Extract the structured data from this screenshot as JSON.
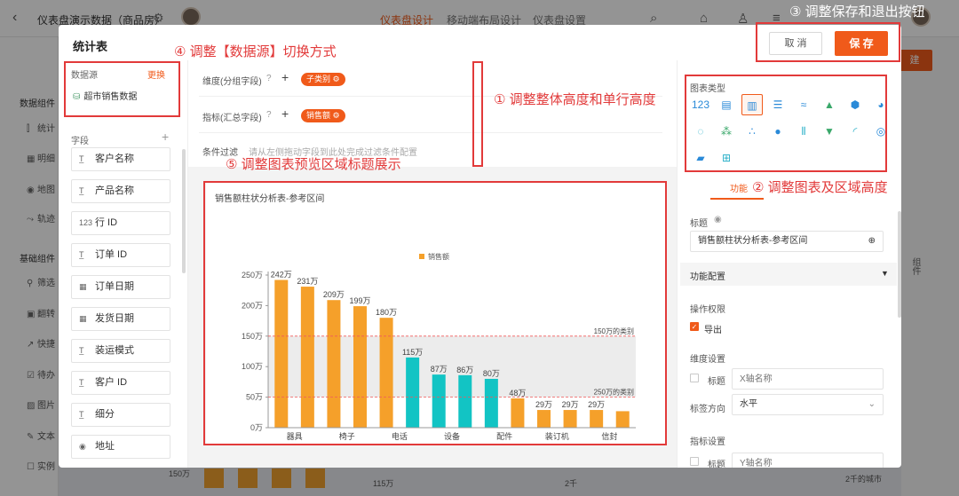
{
  "app": {
    "title": "仪表盘演示数据（商品房）",
    "tabs": [
      "仪表盘设计",
      "移动端布局设计",
      "仪表盘设置"
    ],
    "active_tab": 0,
    "side_sections": [
      "数据组件",
      "基础组件"
    ],
    "side_items_top": [
      "统计",
      "明细",
      "地图",
      "轨迹"
    ],
    "side_items_basic": [
      "筛选",
      "翻转",
      "快捷",
      "待办",
      "图片",
      "文本",
      "实例"
    ],
    "right_vertical_label": "组件",
    "bottom_text": [
      "150万",
      "115万",
      "2千",
      "2千的城市"
    ]
  },
  "modal": {
    "title": "统计表",
    "cancel_label": "取 消",
    "save_label": "保 存"
  },
  "datasource": {
    "label": "数据源",
    "change_label": "更换",
    "name": "超市销售数据"
  },
  "fields": {
    "header": "字段",
    "items": [
      {
        "icon": "T",
        "name": "客户名称"
      },
      {
        "icon": "T",
        "name": "产品名称"
      },
      {
        "icon": "123",
        "name": "行 ID"
      },
      {
        "icon": "T",
        "name": "订单 ID"
      },
      {
        "icon": "cal",
        "name": "订单日期"
      },
      {
        "icon": "cal",
        "name": "发货日期"
      },
      {
        "icon": "T",
        "name": "装运模式"
      },
      {
        "icon": "T",
        "name": "客户 ID"
      },
      {
        "icon": "T",
        "name": "细分"
      },
      {
        "icon": "pin",
        "name": "地址"
      }
    ]
  },
  "config": {
    "dimension_label": "维度(分组字段)",
    "dimension_tag": "子类别",
    "measure_label": "指标(汇总字段)",
    "measure_tag": "销售额",
    "filter_label": "条件过滤",
    "filter_hint": "请从左侧拖动字段到此处完成过滤条件配置"
  },
  "chart_data": {
    "type": "bar",
    "title": "销售额柱状分析表-参考区间",
    "legend": [
      "销售额"
    ],
    "y_unit": "万",
    "y_ticks": [
      "0万",
      "50万",
      "100万",
      "150万",
      "200万",
      "250万"
    ],
    "ylim": [
      0,
      250
    ],
    "categories": [
      "器具",
      "",
      "椅子",
      "",
      "电话",
      "",
      "设备",
      "",
      "配件",
      "",
      "装订机",
      "",
      "信封",
      ""
    ],
    "values": [
      242,
      231,
      209,
      199,
      180,
      115,
      87,
      86,
      80,
      48,
      29,
      29,
      29,
      27
    ],
    "data_labels": [
      "242万",
      "231万",
      "209万",
      "199万",
      "180万",
      "115万",
      "87万",
      "86万",
      "80万",
      "48万",
      "29万",
      "29万",
      "29万",
      ""
    ],
    "bar_colors": [
      "#f5a02a",
      "#f5a02a",
      "#f5a02a",
      "#f5a02a",
      "#f5a02a",
      "#12c4c4",
      "#12c4c4",
      "#12c4c4",
      "#12c4c4",
      "#f5a02a",
      "#f5a02a",
      "#f5a02a",
      "#f5a02a",
      "#f5a02a"
    ],
    "reference_band": [
      50,
      150
    ],
    "reference_lines": [
      {
        "value": 150,
        "label": "150万的类别"
      },
      {
        "value": 50,
        "label": "250万的类别"
      }
    ]
  },
  "right_panel": {
    "chart_type_label": "图表类型",
    "chart_type_icons": [
      "number-icon",
      "table-icon",
      "bar-chart-icon",
      "horizontal-bar-icon",
      "line-chart-icon",
      "area-chart-icon",
      "radar-icon",
      "pie-chart-icon",
      "ring-chart-icon",
      "scatter-cluster-icon",
      "scatter-icon",
      "bubble-icon",
      "dual-bar-icon",
      "funnel-icon",
      "gauge-icon",
      "progress-icon",
      "map-icon",
      "boxplot-icon"
    ],
    "selected_type": 2,
    "function_tab": "功能",
    "title_label": "标题",
    "title_value": "销售额柱状分析表-参考区间",
    "feature_config": "功能配置",
    "permission_label": "操作权限",
    "export_label": "导出",
    "dimension_setting": "维度设置",
    "x_title_label": "标题",
    "x_title_placeholder": "X轴名称",
    "label_direction_label": "标签方向",
    "label_direction_value": "水平",
    "measure_setting": "指标设置",
    "y_title_label": "标题",
    "y_title_placeholder": "Y轴名称"
  },
  "annotations": {
    "a1": "① 调整整体高度和单行高度",
    "a2": "② 调整图表及区域高度",
    "a3": "③ 调整保存和退出按钮",
    "a4": "④ 调整【数据源】切换方式",
    "a5": "⑤ 调整图表预览区域标题展示"
  }
}
